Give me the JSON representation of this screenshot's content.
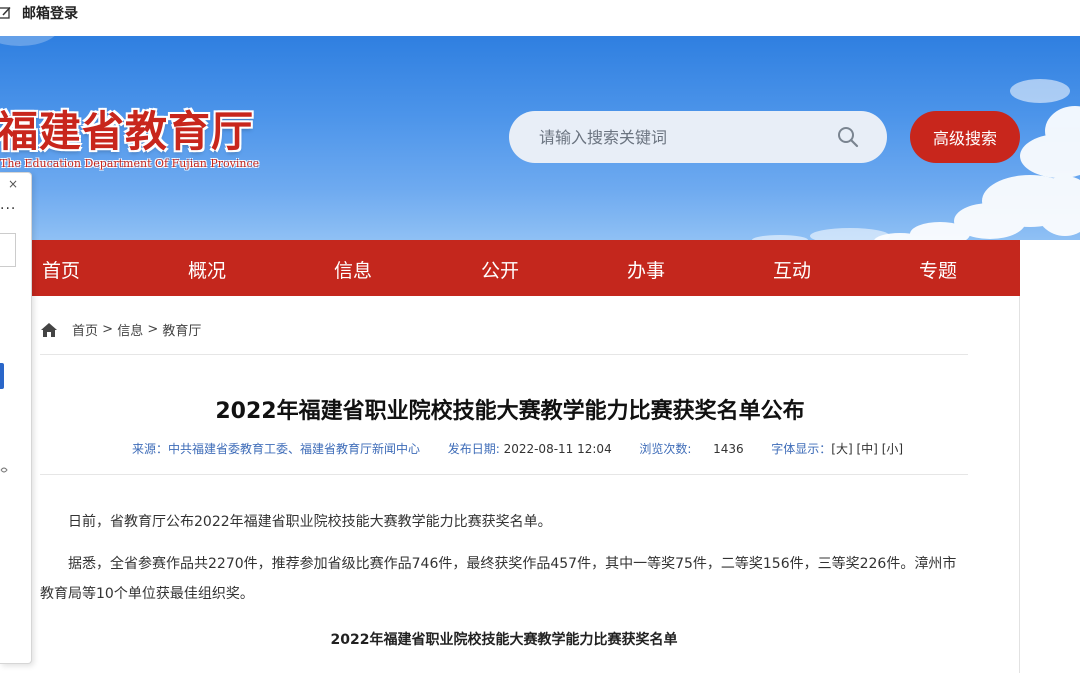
{
  "topbar": {
    "mail_label": "邮箱登录"
  },
  "header": {
    "logo_cn": "福建省教育厅",
    "logo_en": "The Education Department Of Fujian Province",
    "search_placeholder": "请输入搜索关键词",
    "advanced_search_label": "高级搜索"
  },
  "nav": {
    "items": [
      {
        "label": "首页"
      },
      {
        "label": "概况"
      },
      {
        "label": "信息"
      },
      {
        "label": "公开"
      },
      {
        "label": "办事"
      },
      {
        "label": "互动"
      },
      {
        "label": "专题"
      }
    ]
  },
  "left_panel": {
    "close": "×",
    "more": "···"
  },
  "breadcrumb": {
    "home": "首页",
    "sep1": " > ",
    "info": "信息",
    "sep2": " > ",
    "dept": "教育厅"
  },
  "article": {
    "title": "2022年福建省职业院校技能大赛教学能力比赛获奖名单公布",
    "meta": {
      "source_label": "来源：",
      "source_value": "中共福建省委教育工委、福建省教育厅新闻中心",
      "date_label": "发布日期:",
      "date_value": "2022-08-11 12:04",
      "views_label": "浏览次数:",
      "views_value": "1436",
      "font_label": "字体显示：",
      "font_large": "[大]",
      "font_medium": "[中]",
      "font_small": "[小]"
    },
    "paragraphs": [
      "日前，省教育厅公布2022年福建省职业院校技能大赛教学能力比赛获奖名单。",
      "据悉，全省参赛作品共2270件，推荐参加省级比赛作品746件，最终获奖作品457件，其中一等奖75件，二等奖156件，三等奖226件。漳州市教育局等10个单位获最佳组织奖。"
    ],
    "sub_heading": "2022年福建省职业院校技能大赛教学能力比赛获奖名单"
  },
  "colors": {
    "brand_red": "#c4271d",
    "sky_blue": "#4d95ea",
    "link_blue": "#3e6cb8"
  }
}
